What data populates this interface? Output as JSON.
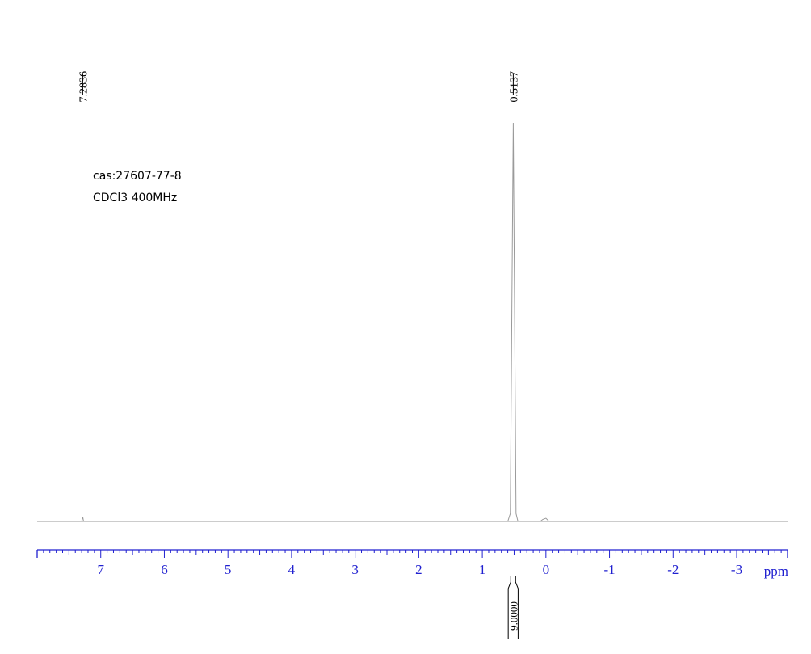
{
  "chart_data": {
    "type": "line",
    "xlabel": "ppm",
    "x_reversed": true,
    "xlim": [
      -3.8,
      8.0
    ],
    "x_ticks": [
      7,
      6,
      5,
      4,
      3,
      2,
      1,
      0,
      -1,
      -2,
      -3
    ],
    "x_tick_labels": [
      "7",
      "6",
      "5",
      "4",
      "3",
      "2",
      "1",
      "0",
      "-1",
      "-2",
      "-3"
    ],
    "annotations": [
      "cas:27607-77-8",
      "CDCl3  400MHz"
    ],
    "peak_labels": [
      {
        "ppm": 7.2836,
        "label": "7.2836"
      },
      {
        "ppm": 0.5137,
        "label": "0.5137"
      }
    ],
    "series": [
      {
        "x": [
          8.0,
          7.3,
          7.2836,
          7.27,
          0.6,
          0.56,
          0.5137,
          0.47,
          0.44,
          0.09,
          0.05,
          0.0,
          -0.05,
          -3.8
        ],
        "values": [
          0,
          0,
          0.012,
          0,
          0,
          0.02,
          1.0,
          0.02,
          0,
          0,
          0.005,
          0.008,
          0,
          0
        ]
      }
    ],
    "integrals": [
      {
        "from": 0.58,
        "to": 0.45,
        "value": "9.0000"
      }
    ],
    "colors": {
      "spectrum": "#9a9a9a",
      "axis": "#2020d0",
      "labels": "#000000"
    }
  }
}
